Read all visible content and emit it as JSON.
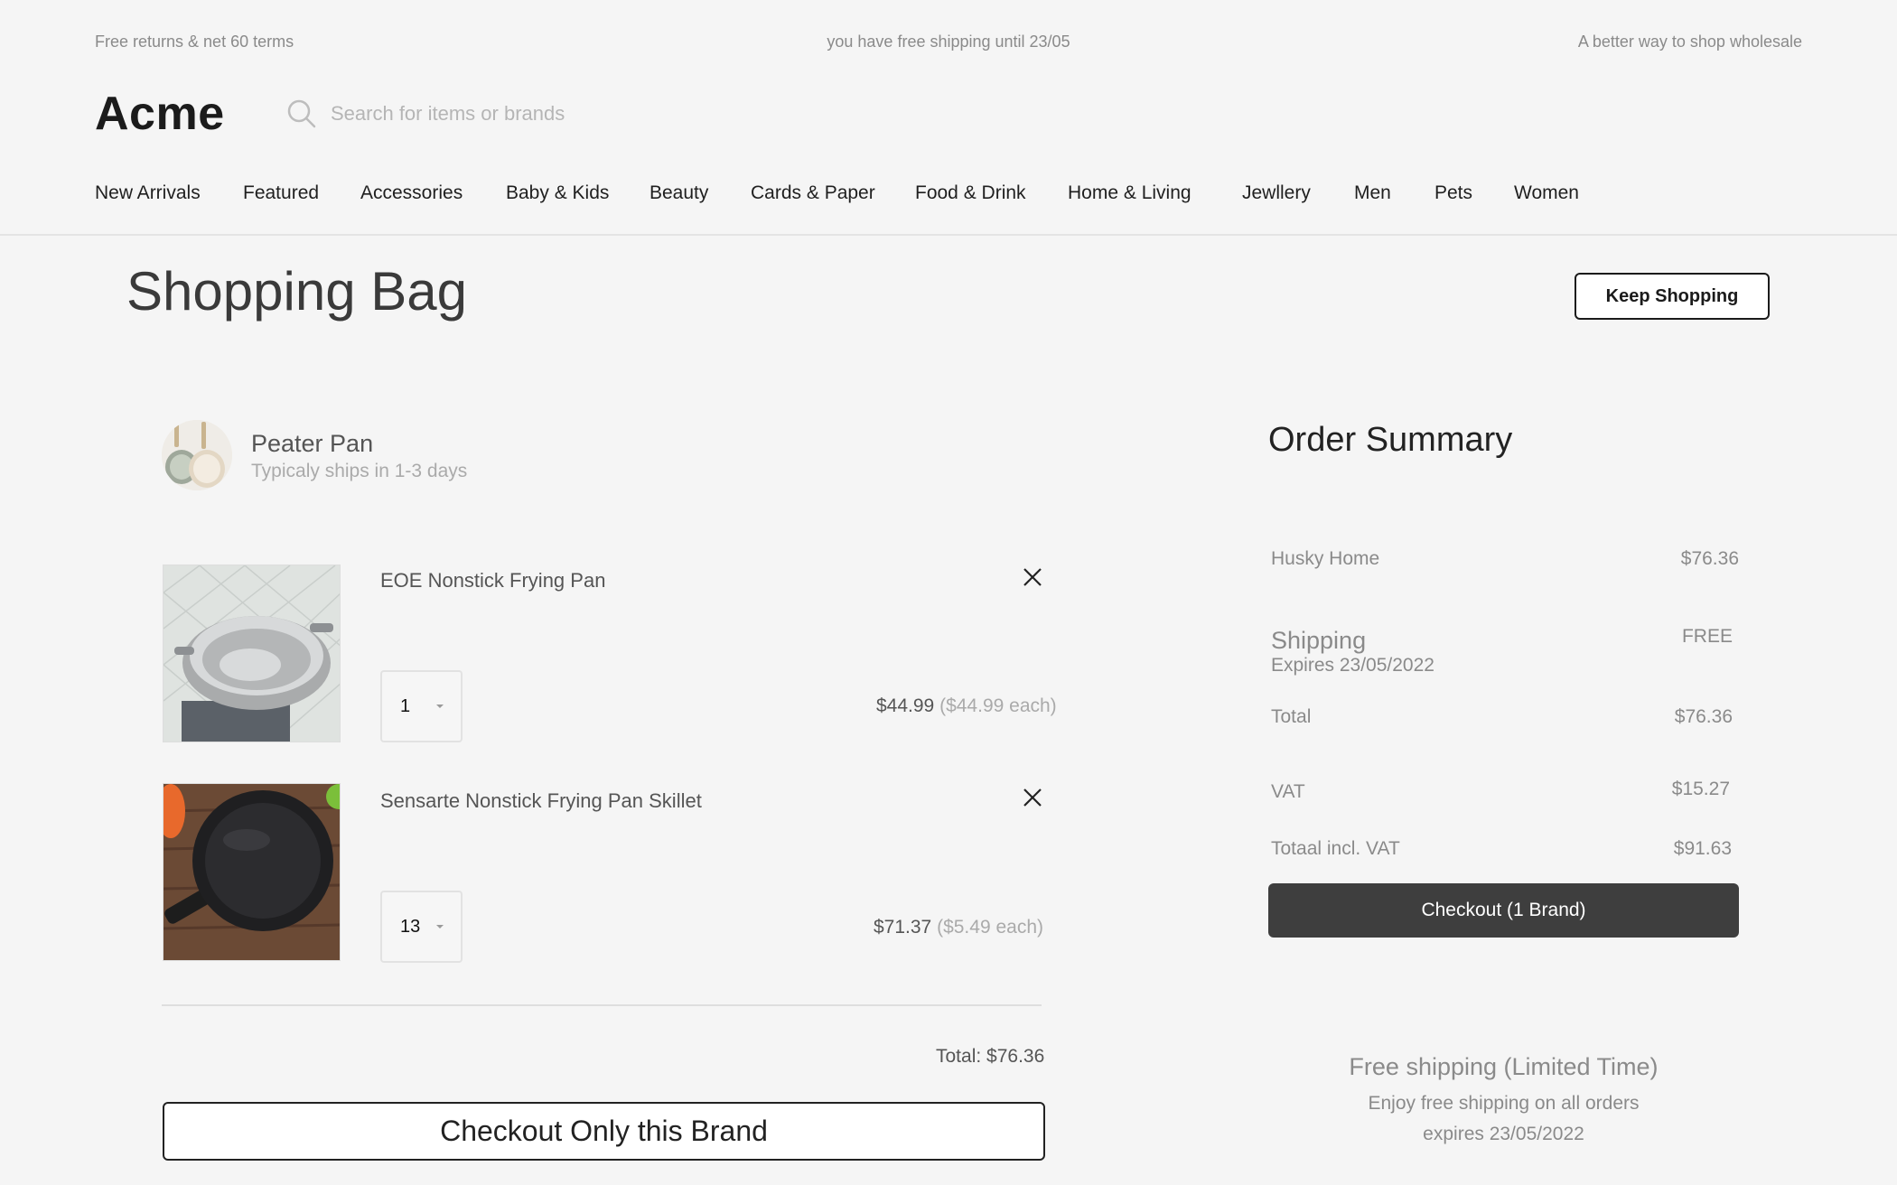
{
  "promo_bar": {
    "left": "Free returns & net 60 terms",
    "center": "you have free shipping until 23/05",
    "right": "A better way to shop wholesale"
  },
  "header": {
    "logo": "Acme",
    "search_placeholder": "Search for items or brands",
    "search_icon": "search-icon"
  },
  "nav": [
    "New Arrivals",
    "Featured",
    "Accessories",
    "Baby & Kids",
    "Beauty",
    "Cards & Paper",
    "Food & Drink",
    "Home & Living",
    "Jewllery",
    "Men",
    "Pets",
    "Women"
  ],
  "page": {
    "title": "Shopping Bag",
    "keep_shopping_label": "Keep Shopping"
  },
  "brand": {
    "name": "Peater Pan",
    "shipping_note": "Typicaly ships in 1-3 days"
  },
  "items": [
    {
      "name": "EOE Nonstick Frying Pan",
      "quantity": "1",
      "price": "$44.99",
      "unit_price": "($44.99  each)",
      "remove_icon": "close-icon"
    },
    {
      "name": "Sensarte Nonstick Frying Pan Skillet",
      "quantity": "13",
      "price": "$71.37",
      "unit_price": "($5.49  each)",
      "remove_icon": "close-icon"
    }
  ],
  "brand_total": "Total: $76.36",
  "checkout_brand_label": "Checkout Only this Brand",
  "summary": {
    "title": "Order Summary",
    "store_label": "Husky Home",
    "store_value": "$76.36",
    "shipping_label": "Shipping",
    "shipping_value": "FREE",
    "shipping_expiry": "Expires 23/05/2022",
    "total_label": "Total",
    "total_value": "$76.36",
    "vat_label": "VAT",
    "vat_value": "$15.27",
    "grand_label": "Totaal incl. VAT",
    "grand_value": "$91.63",
    "checkout_label": "Checkout (1 Brand)"
  },
  "free_shipping": {
    "title": "Free shipping (Limited Time)",
    "line1": "Enjoy free shipping on all orders",
    "line2": "expires 23/05/2022"
  },
  "colors": {
    "background": "#f5f5f5",
    "primary_button": "#3e3e3e",
    "text_dark": "#1b1b1b",
    "text_muted": "#8a8a8a"
  }
}
